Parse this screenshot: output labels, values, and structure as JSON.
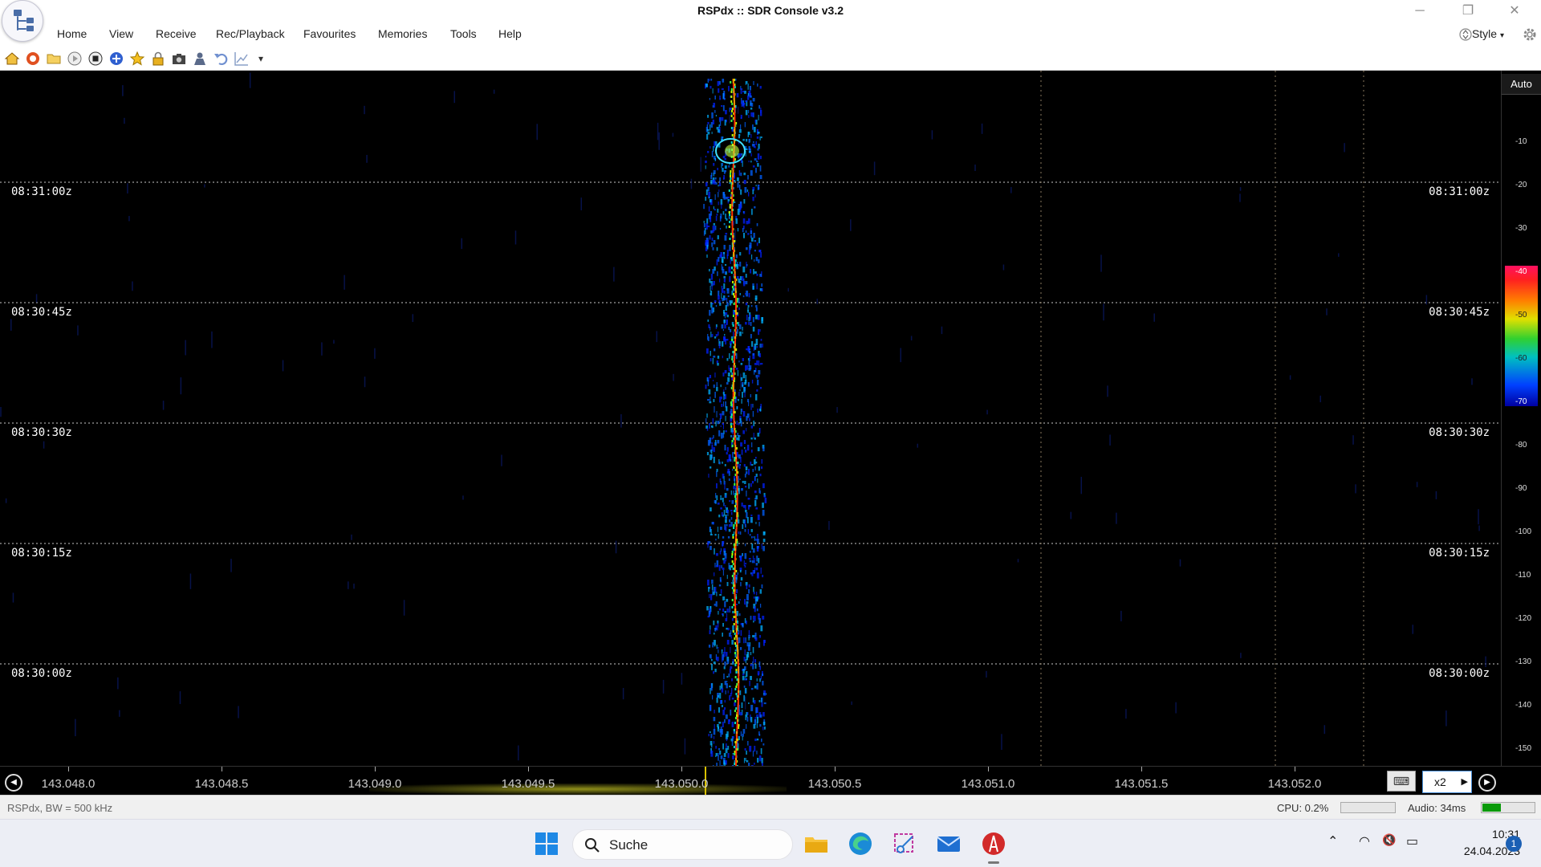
{
  "window": {
    "title": "RSPdx :: SDR Console v3.2",
    "controls": {
      "minimize": "─",
      "restore": "❐",
      "close": "✕"
    }
  },
  "menu": {
    "items": [
      "Home",
      "View",
      "Receive",
      "Rec/Playback",
      "Favourites",
      "Memories",
      "Tools",
      "Help"
    ],
    "style_label": "Style"
  },
  "toolbar": {
    "icons": [
      "home-icon",
      "lifebuoy-icon",
      "folder-icon",
      "play-icon",
      "stop-icon",
      "add-icon",
      "star-icon",
      "lock-icon",
      "camera-icon",
      "user-icon",
      "undo-icon",
      "chart-icon",
      "more-icon"
    ],
    "more_glyph": "▾"
  },
  "waterfall": {
    "time_markers": [
      "08:31:00z",
      "08:30:45z",
      "08:30:30z",
      "08:30:15z",
      "08:30:00z"
    ],
    "scale": {
      "auto_label": "Auto",
      "ticks": [
        "-10",
        "-20",
        "-30",
        "-40",
        "-50",
        "-60",
        "-70",
        "-80",
        "-90",
        "-100",
        "-110",
        "-120",
        "-130",
        "-140",
        "-150"
      ]
    }
  },
  "frequency_axis": {
    "labels": [
      "143.048.0",
      "143.048.5",
      "143.049.0",
      "143.049.5",
      "143.050.0",
      "143.050.5",
      "143.051.0",
      "143.051.5",
      "143.052.0"
    ],
    "zoom_value": "x2",
    "zoom_arrow": "▶",
    "keyboard_glyph": "⌨",
    "left_nav_glyph": "◀",
    "right_nav_glyph": "▶"
  },
  "status_bar": {
    "device_info": "RSPdx, BW = 500 kHz",
    "cpu": "CPU: 0.2%",
    "audio": "Audio: 34ms",
    "audio_level": 0.35,
    "cpu_level": 0.002
  },
  "taskbar": {
    "search_placeholder": "Suche",
    "time": "10:31",
    "date": "24.04.2023",
    "notification_count": "1",
    "tray_chevron": "⌃",
    "wifi_glyph": "◠",
    "speaker_glyph": "🔇",
    "battery_glyph": "▭"
  },
  "colors": {
    "accent": "#1a5fb4",
    "waterfall_bg": "#000000",
    "signal_core": "#ff3000"
  }
}
